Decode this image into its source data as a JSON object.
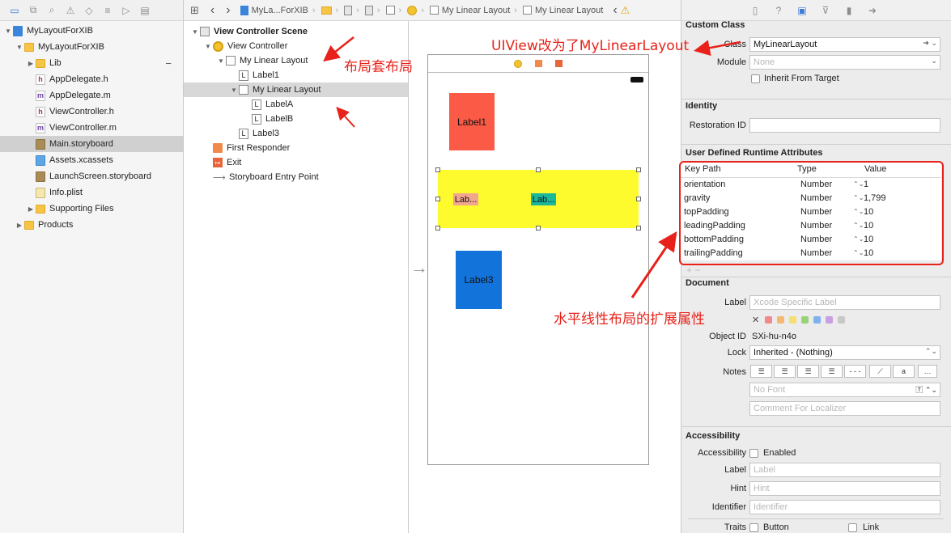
{
  "navigator": {
    "toolbar_icons": [
      "folder-icon",
      "hierarchy-icon",
      "search-icon",
      "warning-icon",
      "test-icon",
      "debug-icon",
      "breakpoint-icon",
      "report-icon"
    ],
    "items": [
      {
        "name": "MyLayoutForXIB",
        "icon": "project-icon",
        "indent": 0,
        "disclosure": "▼"
      },
      {
        "name": "MyLayoutForXIB",
        "icon": "folder-icon",
        "indent": 1,
        "disclosure": "▼"
      },
      {
        "name": "Lib",
        "icon": "folder-icon",
        "indent": 2,
        "disclosure": "▶"
      },
      {
        "name": "AppDelegate.h",
        "icon": "h-file-icon",
        "indent": 2,
        "disclosure": ""
      },
      {
        "name": "AppDelegate.m",
        "icon": "m-file-icon",
        "indent": 2,
        "disclosure": ""
      },
      {
        "name": "ViewController.h",
        "icon": "h-file-icon",
        "indent": 2,
        "disclosure": ""
      },
      {
        "name": "ViewController.m",
        "icon": "m-file-icon",
        "indent": 2,
        "disclosure": ""
      },
      {
        "name": "Main.storyboard",
        "icon": "storyboard-icon",
        "indent": 2,
        "disclosure": "",
        "selected": true
      },
      {
        "name": "Assets.xcassets",
        "icon": "assets-icon",
        "indent": 2,
        "disclosure": ""
      },
      {
        "name": "LaunchScreen.storyboard",
        "icon": "storyboard-icon",
        "indent": 2,
        "disclosure": ""
      },
      {
        "name": "Info.plist",
        "icon": "plist-icon",
        "indent": 2,
        "disclosure": ""
      },
      {
        "name": "Supporting Files",
        "icon": "folder-icon",
        "indent": 2,
        "disclosure": "▶"
      },
      {
        "name": "Products",
        "icon": "folder-icon",
        "indent": 1,
        "disclosure": "▶"
      }
    ],
    "lib_minus": "−"
  },
  "jumpbar": {
    "project_crumb": "MyLa...ForXIB",
    "crumb_scene": "My Linear Layout",
    "crumb_view": "My Linear Layout",
    "back": "‹",
    "forward": "›",
    "warning": "⚠"
  },
  "outline": {
    "items": [
      {
        "label": "View Controller Scene",
        "icon": "scene-icon",
        "indent": 0,
        "disclosure": "▼",
        "bold": true
      },
      {
        "label": "View Controller",
        "icon": "view-controller-icon",
        "indent": 1,
        "disclosure": "▼"
      },
      {
        "label": "My Linear Layout",
        "icon": "view-icon",
        "indent": 2,
        "disclosure": "▼"
      },
      {
        "label": "Label1",
        "icon": "label-icon",
        "indent": 3,
        "disclosure": ""
      },
      {
        "label": "My Linear Layout",
        "icon": "view-icon",
        "indent": 3,
        "disclosure": "▼",
        "selected": true
      },
      {
        "label": "LabelA",
        "icon": "label-icon",
        "indent": 4,
        "disclosure": ""
      },
      {
        "label": "LabelB",
        "icon": "label-icon",
        "indent": 4,
        "disclosure": ""
      },
      {
        "label": "Label3",
        "icon": "label-icon",
        "indent": 3,
        "disclosure": ""
      },
      {
        "label": "First Responder",
        "icon": "first-responder-icon",
        "indent": 1,
        "disclosure": ""
      },
      {
        "label": "Exit",
        "icon": "exit-icon",
        "indent": 1,
        "disclosure": ""
      },
      {
        "label": "Storyboard Entry Point",
        "icon": "entry-arrow-icon",
        "indent": 1,
        "disclosure": ""
      }
    ]
  },
  "canvas": {
    "label1": "Label1",
    "labelA": "Lab...",
    "labelB": "Lab...",
    "label3": "Label3",
    "entry_arrow": "→",
    "colors": {
      "label1": "#fa5a46",
      "linear": "#fdfb2d",
      "labelA": "#f2a58f",
      "labelB": "#1ab79a",
      "label3": "#1273db"
    }
  },
  "inspector": {
    "toolbar_icons": [
      "file-inspector-icon",
      "help-icon",
      "identity-inspector-icon",
      "attributes-inspector-icon",
      "size-inspector-icon",
      "connections-inspector-icon"
    ],
    "custom_class": {
      "title": "Custom Class",
      "class_label": "Class",
      "class_value": "MyLinearLayout",
      "module_label": "Module",
      "module_placeholder": "None",
      "inherit_label": "Inherit From Target"
    },
    "identity": {
      "title": "Identity",
      "restoration_label": "Restoration ID"
    },
    "runtime_attributes": {
      "title": "User Defined Runtime Attributes",
      "columns": [
        "Key Path",
        "Type",
        "Value"
      ],
      "rows": [
        {
          "key": "orientation",
          "type": "Number",
          "value": "1"
        },
        {
          "key": "gravity",
          "type": "Number",
          "value": "1,799"
        },
        {
          "key": "topPadding",
          "type": "Number",
          "value": "10"
        },
        {
          "key": "leadingPadding",
          "type": "Number",
          "value": "10"
        },
        {
          "key": "bottomPadding",
          "type": "Number",
          "value": "10"
        },
        {
          "key": "trailingPadding",
          "type": "Number",
          "value": "10"
        }
      ],
      "add_remove": "+ −"
    },
    "document": {
      "title": "Document",
      "label_label": "Label",
      "label_placeholder": "Xcode Specific Label",
      "object_id_label": "Object ID",
      "object_id_value": "SXi-hu-n4o",
      "lock_label": "Lock",
      "lock_value": "Inherited - (Nothing)",
      "notes_label": "Notes",
      "font_placeholder": "No Font",
      "comment_placeholder": "Comment For Localizer",
      "clear_color": "✕",
      "color_chips": [
        "#f08a8a",
        "#f5b870",
        "#f2e070",
        "#9ad27a",
        "#7fb1ee",
        "#c9a0e3",
        "#c8c8c8"
      ]
    },
    "accessibility": {
      "title": "Accessibility",
      "accessibility_label": "Accessibility",
      "enabled_label": "Enabled",
      "label_label": "Label",
      "label_placeholder": "Label",
      "hint_label": "Hint",
      "hint_placeholder": "Hint",
      "identifier_label": "Identifier",
      "identifier_placeholder": "Identifier",
      "traits_label": "Traits",
      "button_label": "Button",
      "link_label": "Link"
    }
  },
  "annotations": {
    "nested_layout": "布局套布局",
    "class_changed": "UIView改为了MyLinearLayout",
    "extended_props": "水平线性布局的扩展属性"
  }
}
